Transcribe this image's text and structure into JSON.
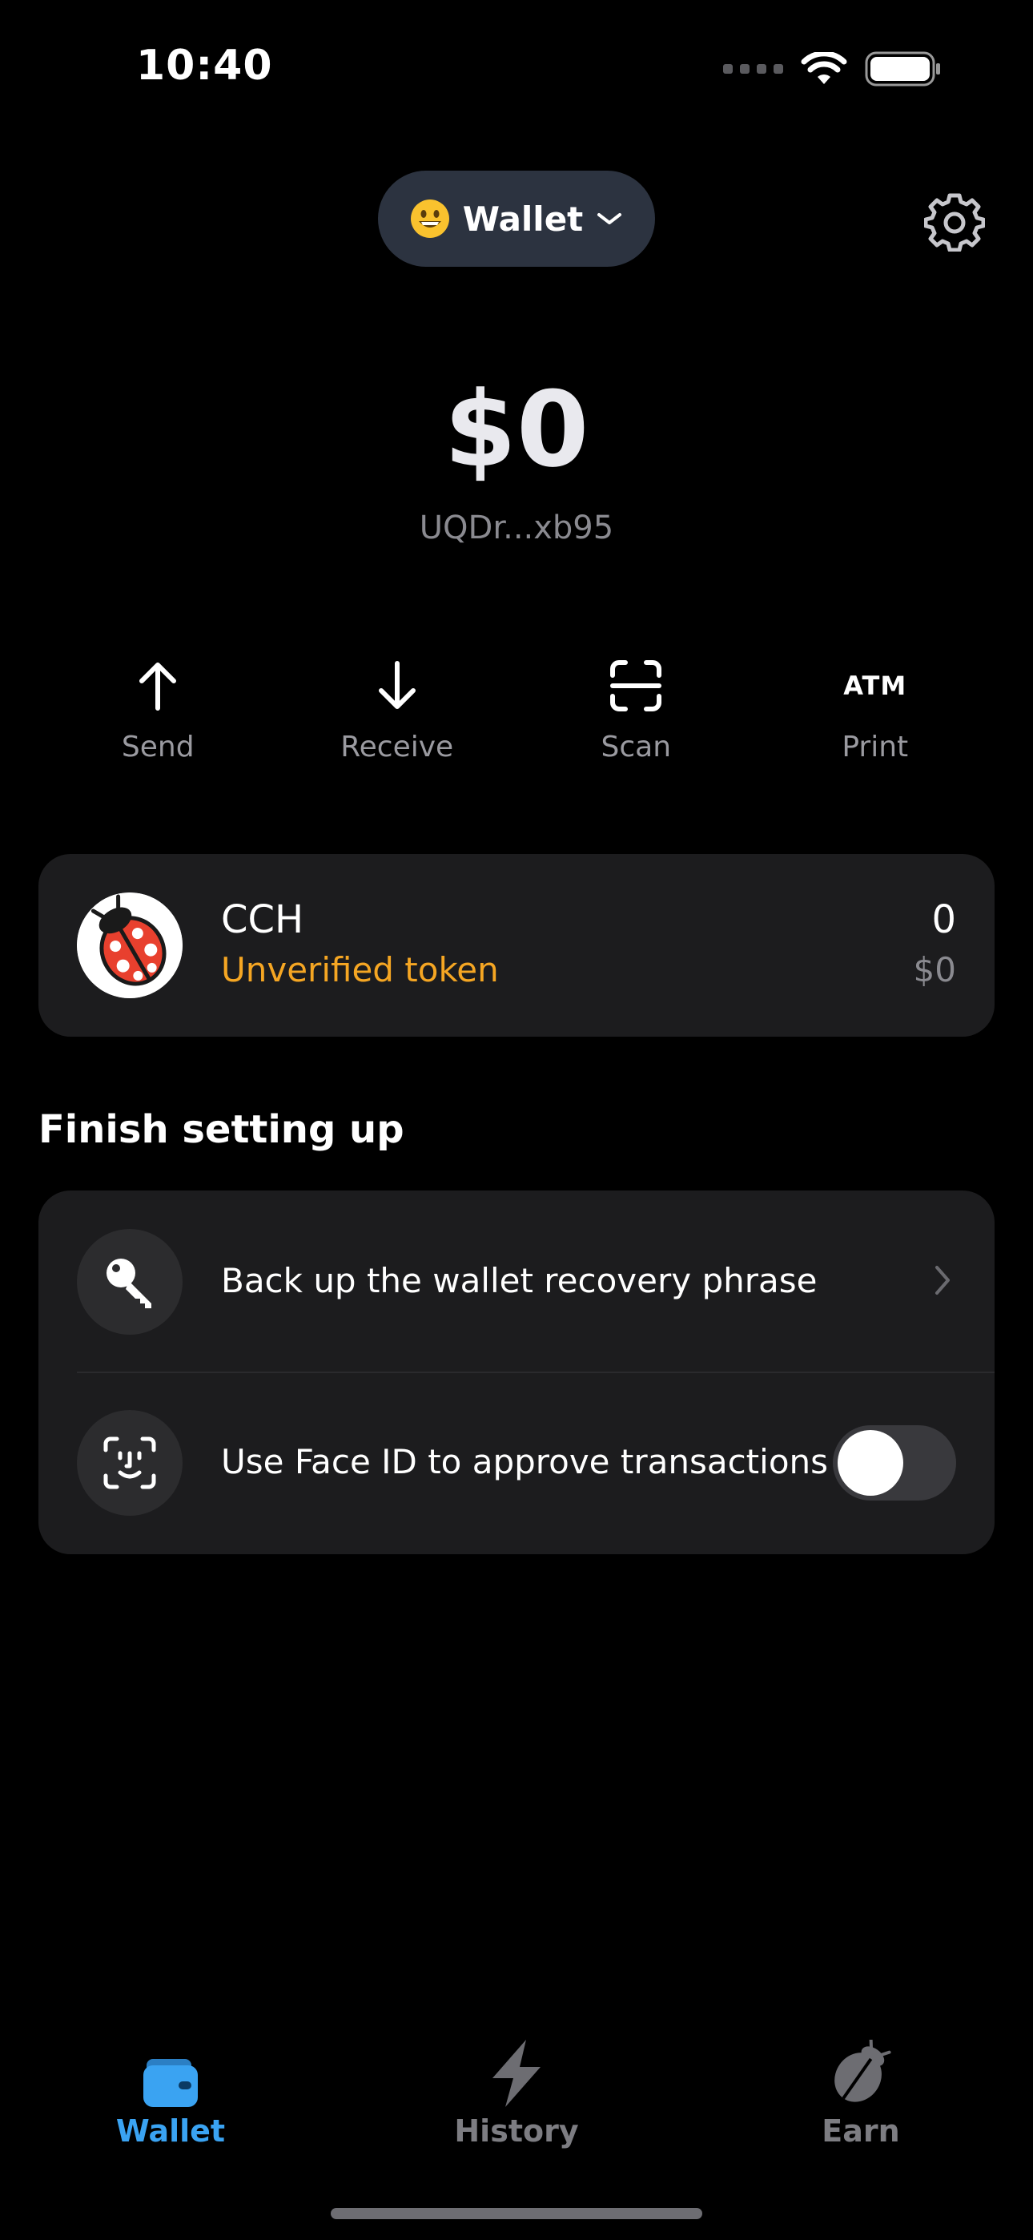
{
  "status_bar": {
    "time": "10:40"
  },
  "header": {
    "wallet_label": "Wallet"
  },
  "balance": {
    "amount": "$0",
    "address": "UQDr...xb95"
  },
  "actions": [
    {
      "label": "Send",
      "icon": "arrow-up-icon"
    },
    {
      "label": "Receive",
      "icon": "arrow-down-icon"
    },
    {
      "label": "Scan",
      "icon": "scan-icon"
    },
    {
      "label": "Print",
      "icon": "atm-icon",
      "icon_text": "ATM"
    }
  ],
  "token": {
    "name": "CCH",
    "status": "Unverified token",
    "amount": "0",
    "fiat": "$0"
  },
  "setup": {
    "title": "Finish setting up",
    "items": [
      {
        "label": "Back up the wallet recovery phrase",
        "icon": "key-icon"
      },
      {
        "label": "Use Face ID to approve transactions",
        "icon": "face-id-icon",
        "toggle_on": false
      }
    ]
  },
  "tabs": [
    {
      "label": "Wallet",
      "icon": "wallet-icon",
      "active": true
    },
    {
      "label": "History",
      "icon": "lightning-icon",
      "active": false
    },
    {
      "label": "Earn",
      "icon": "ladybug-icon",
      "active": false
    }
  ],
  "colors": {
    "accent": "#3aa3f2",
    "warning": "#f5a623",
    "card": "#1c1c1e",
    "pill": "#2c3340"
  }
}
